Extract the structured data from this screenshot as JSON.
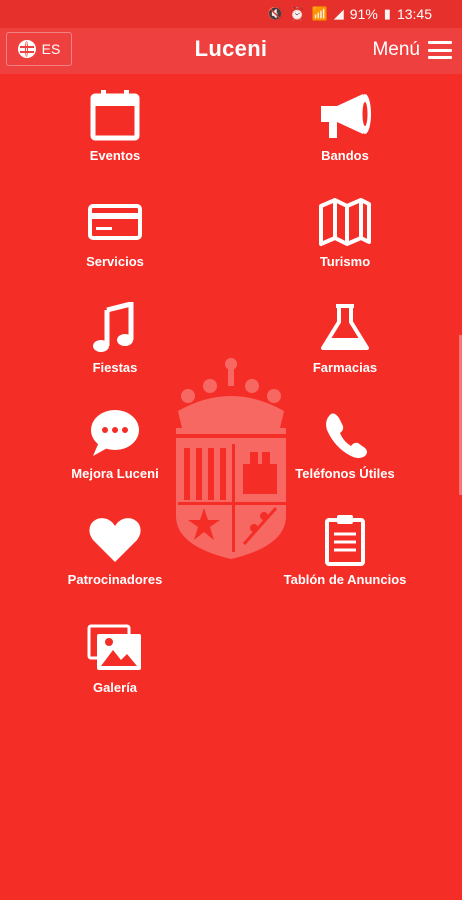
{
  "status_bar": {
    "battery": "91%",
    "time": "13:45"
  },
  "top_bar": {
    "language": "ES",
    "title": "Luceni",
    "menu_label": "Menú"
  },
  "grid": {
    "items": [
      {
        "label": "Eventos",
        "icon": "calendar-icon"
      },
      {
        "label": "Bandos",
        "icon": "megaphone-icon"
      },
      {
        "label": "Servicios",
        "icon": "credit-card-icon"
      },
      {
        "label": "Turismo",
        "icon": "map-icon"
      },
      {
        "label": "Fiestas",
        "icon": "music-note-icon"
      },
      {
        "label": "Farmacias",
        "icon": "flask-icon"
      },
      {
        "label": "Mejora Luceni",
        "icon": "chat-bubble-icon"
      },
      {
        "label": "Teléfonos Útiles",
        "icon": "phone-icon"
      },
      {
        "label": "Patrocinadores",
        "icon": "heart-icon"
      },
      {
        "label": "Tablón de Anuncios",
        "icon": "clipboard-icon"
      },
      {
        "label": "Galería",
        "icon": "gallery-icon"
      }
    ]
  },
  "colors": {
    "background": "#f52d27",
    "topbar": "#ef4040"
  }
}
